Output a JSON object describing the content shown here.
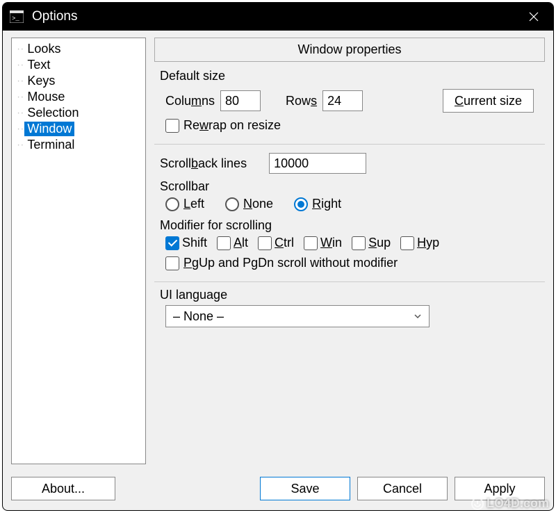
{
  "window": {
    "title": "Options"
  },
  "tree": {
    "items": [
      {
        "label": "Looks"
      },
      {
        "label": "Text"
      },
      {
        "label": "Keys"
      },
      {
        "label": "Mouse"
      },
      {
        "label": "Selection"
      },
      {
        "label": "Window",
        "selected": true
      },
      {
        "label": "Terminal"
      }
    ]
  },
  "panel": {
    "title": "Window properties",
    "default_size": {
      "group_label": "Default size",
      "columns_label": "Columns",
      "columns_value": "80",
      "rows_label": "Rows",
      "rows_value": "24",
      "current_size_btn": "Current size",
      "rewrap_label": "Rewrap on resize",
      "rewrap_checked": false
    },
    "scrollback": {
      "lines_label": "Scrollback lines",
      "lines_value": "10000",
      "scrollbar_label": "Scrollbar",
      "scrollbar_options": [
        {
          "label": "Left",
          "checked": false
        },
        {
          "label": "None",
          "checked": false
        },
        {
          "label": "Right",
          "checked": true
        }
      ],
      "modifier_label": "Modifier for scrolling",
      "modifiers": [
        {
          "label": "Shift",
          "checked": true
        },
        {
          "label": "Alt",
          "checked": false
        },
        {
          "label": "Ctrl",
          "checked": false
        },
        {
          "label": "Win",
          "checked": false
        },
        {
          "label": "Sup",
          "checked": false
        },
        {
          "label": "Hyp",
          "checked": false
        }
      ],
      "pgupdn_label": "PgUp and PgDn scroll without modifier",
      "pgupdn_checked": false
    },
    "ui_language": {
      "label": "UI language",
      "value": "– None –"
    }
  },
  "footer": {
    "about": "About...",
    "save": "Save",
    "cancel": "Cancel",
    "apply": "Apply"
  },
  "watermark": "LO4D.com"
}
